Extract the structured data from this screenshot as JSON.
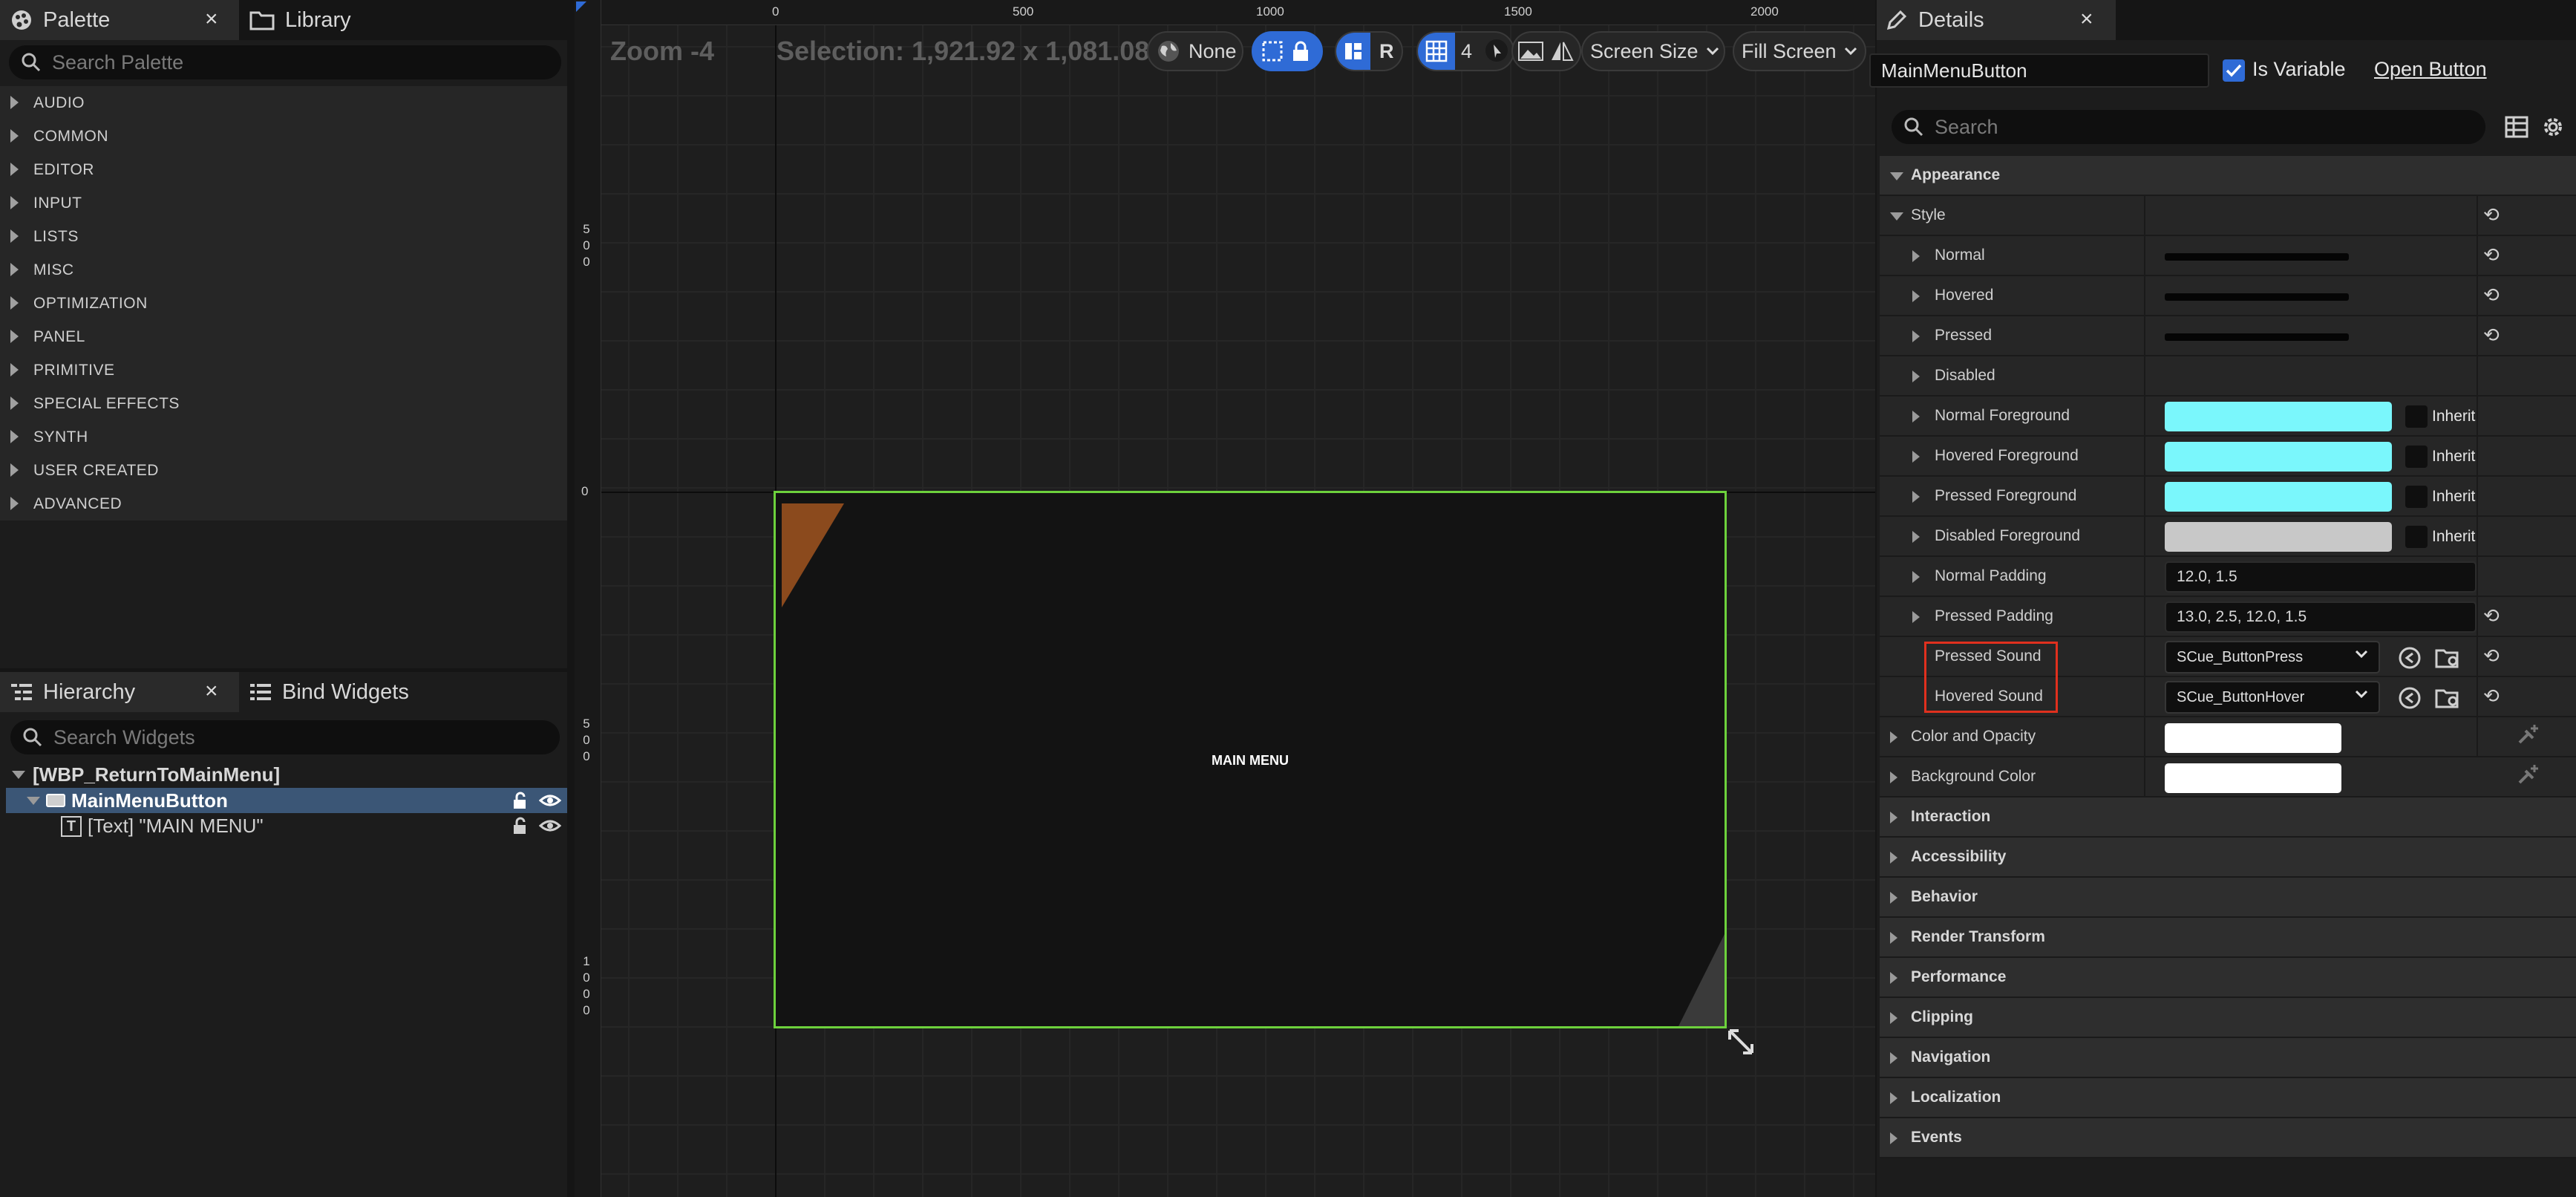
{
  "palette": {
    "tab_label": "Palette",
    "library_tab_label": "Library",
    "search_placeholder": "Search Palette",
    "categories": [
      "AUDIO",
      "COMMON",
      "EDITOR",
      "INPUT",
      "LISTS",
      "MISC",
      "OPTIMIZATION",
      "PANEL",
      "PRIMITIVE",
      "SPECIAL EFFECTS",
      "SYNTH",
      "USER CREATED",
      "ADVANCED"
    ]
  },
  "hierarchy": {
    "tab_label": "Hierarchy",
    "bind_tab_label": "Bind Widgets",
    "search_placeholder": "Search Widgets",
    "root": "[WBP_ReturnToMainMenu]",
    "button": "MainMenuButton",
    "text_child": "[Text] \"MAIN MENU\""
  },
  "designer": {
    "zoom": "Zoom -4",
    "selection": "Selection: 1,921.92 x 1,081.08",
    "toolbar": {
      "localize_label": "None",
      "r_label": "R",
      "grid_value": "4",
      "screen_size_label": "Screen Size",
      "fill_screen_label": "Fill Screen"
    },
    "ruler_top": [
      "0",
      "500",
      "1000",
      "1500",
      "2000"
    ],
    "ruler_left": [
      "500",
      "0",
      "500",
      "1000"
    ],
    "widget_text": "MAIN MENU"
  },
  "details": {
    "tab_label": "Details",
    "widget_name": "MainMenuButton",
    "is_variable_label": "Is Variable",
    "is_variable_checked": true,
    "open_button_label": "Open Button",
    "search_placeholder": "Search",
    "appearance_label": "Appearance",
    "style_label": "Style",
    "normal_label": "Normal",
    "hovered_label": "Hovered",
    "pressed_label": "Pressed",
    "disabled_label": "Disabled",
    "normal_fg_label": "Normal Foreground",
    "hovered_fg_label": "Hovered Foreground",
    "pressed_fg_label": "Pressed Foreground",
    "disabled_fg_label": "Disabled Foreground",
    "inherit_label": "Inherit",
    "normal_padding_label": "Normal Padding",
    "normal_padding_value": "12.0, 1.5",
    "pressed_padding_label": "Pressed Padding",
    "pressed_padding_value": "13.0, 2.5, 12.0, 1.5",
    "pressed_sound_label": "Pressed Sound",
    "pressed_sound_value": "SCue_ButtonPress",
    "hovered_sound_label": "Hovered Sound",
    "hovered_sound_value": "SCue_ButtonHover",
    "color_opacity_label": "Color and Opacity",
    "background_color_label": "Background Color",
    "sections": [
      "Interaction",
      "Accessibility",
      "Behavior",
      "Render Transform",
      "Performance",
      "Clipping",
      "Navigation",
      "Localization",
      "Events"
    ]
  },
  "colors": {
    "accent_blue": "#2f6bd6",
    "foreground_cyan": "#7af7fc",
    "disabled_gray": "#c8c8c8",
    "selection_green": "#6dd13c",
    "highlight_red": "#e0301e",
    "brand_orange": "#8b4a1d"
  },
  "icons": {
    "palette_tab": "palette-icon",
    "library_tab": "folder-icon",
    "hierarchy_tab": "hierarchy-icon",
    "details_tab": "pencil-icon",
    "lock": "lock-icon",
    "visibility": "eye-icon",
    "undo": "reset-arrow-icon"
  }
}
